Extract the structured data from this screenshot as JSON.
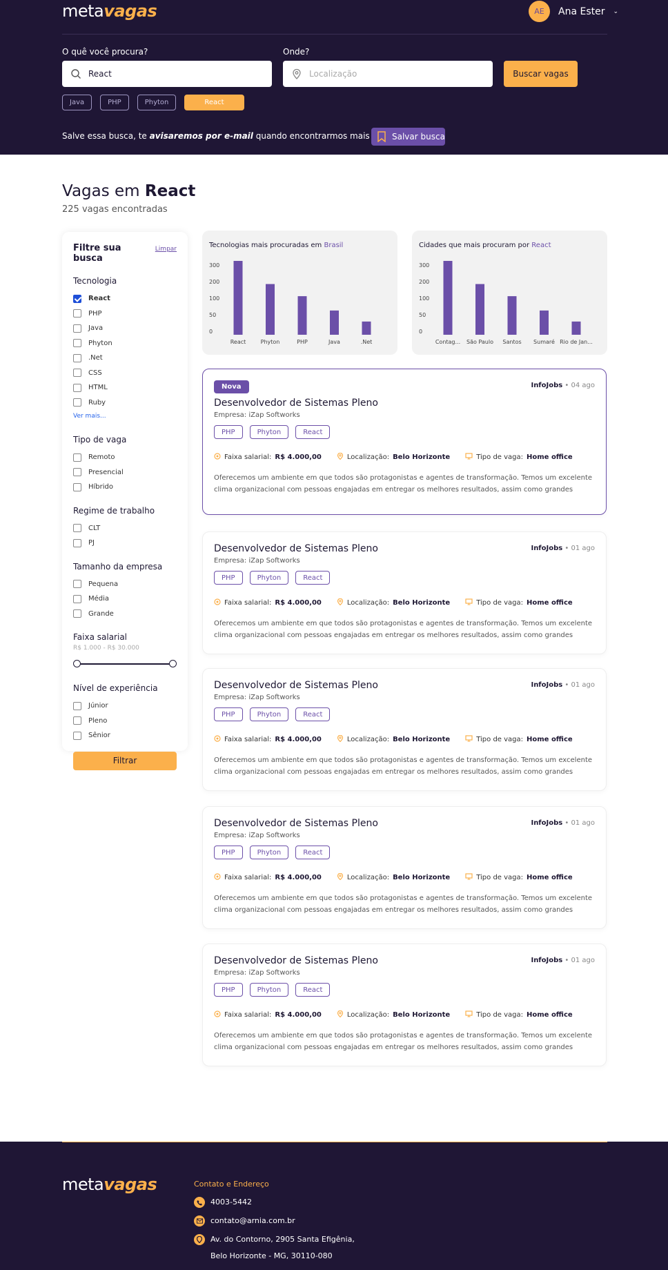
{
  "brand": {
    "logo_a": "meta",
    "logo_b": "vagas"
  },
  "user": {
    "initials": "AE",
    "name": "Ana Ester"
  },
  "search": {
    "what_label": "O quê você procura?",
    "what_value": "React",
    "where_label": "Onde?",
    "where_placeholder": "Localização",
    "button": "Buscar vagas"
  },
  "chips": [
    "Java",
    "PHP",
    "Phyton",
    "React"
  ],
  "save": {
    "text_a": "Salve essa busca, te ",
    "text_b": "avisaremos por e-mail",
    "text_c": " quando encontrarmos mais vagas",
    "button": "Salvar busca"
  },
  "results": {
    "title_a": "Vagas em ",
    "title_b": "React",
    "count": "225 vagas encontradas"
  },
  "filters": {
    "title": "Filtre sua busca",
    "clear": "Limpar",
    "tecnologia": {
      "label": "Tecnologia",
      "items": [
        {
          "label": "React",
          "checked": true
        },
        {
          "label": "PHP",
          "checked": false
        },
        {
          "label": "Java",
          "checked": false
        },
        {
          "label": "Phyton",
          "checked": false
        },
        {
          "label": ".Net",
          "checked": false
        },
        {
          "label": "CSS",
          "checked": false
        },
        {
          "label": "HTML",
          "checked": false
        },
        {
          "label": "Ruby",
          "checked": false
        }
      ],
      "more": "Ver mais..."
    },
    "tipo": {
      "label": "Tipo de vaga",
      "items": [
        "Remoto",
        "Presencial",
        "Híbrido"
      ]
    },
    "regime": {
      "label": "Regime de trabalho",
      "items": [
        "CLT",
        "PJ"
      ]
    },
    "tamanho": {
      "label": "Tamanho da empresa",
      "items": [
        "Pequena",
        "Média",
        "Grande"
      ]
    },
    "salario": {
      "label": "Faixa salarial",
      "range": "R$ 1.000 - R$ 30.000"
    },
    "nivel": {
      "label": "Nível de experiência",
      "items": [
        "Júnior",
        "Pleno",
        "Sênior"
      ]
    },
    "button": "Filtrar"
  },
  "chart_data": [
    {
      "type": "bar",
      "title_a": "Tecnologias mais procuradas em ",
      "title_b": "Brasil",
      "categories": [
        "React",
        "Phyton",
        "PHP",
        "Java",
        ".Net"
      ],
      "values": [
        335,
        230,
        175,
        110,
        60
      ],
      "yticks": [
        "300",
        "200",
        "100",
        "50",
        "0"
      ],
      "accent": "#6b4fa8"
    },
    {
      "type": "bar",
      "title_a": "Cidades que mais procuram por ",
      "title_b": "React",
      "categories": [
        "Contag...",
        "São Paulo",
        "Santos",
        "Sumaré",
        "Rio de Jan..."
      ],
      "values": [
        335,
        230,
        175,
        110,
        60
      ],
      "yticks": [
        "300",
        "200",
        "100",
        "50",
        "0"
      ],
      "accent": "#6b4fa8"
    }
  ],
  "jobs": [
    {
      "new": true,
      "badge": "Nova",
      "source": "InfoJobs",
      "ago": "04 ago",
      "title": "Desenvolvedor de Sistemas Pleno",
      "company": "Empresa: iZap Softworks",
      "tags": [
        "PHP",
        "Phyton",
        "React"
      ],
      "salary_label": "Faixa salarial: ",
      "salary": "R$ 4.000,00",
      "loc_label": "Localização: ",
      "loc": "Belo Horizonte",
      "type_label": "Tipo de vaga: ",
      "type": "Home office",
      "desc": "Oferecemos um ambiente em que todos são protagonistas e agentes de transformação. Temos um excelente clima organizacional com pessoas engajadas em entregar os melhores resultados, assim como grandes oportunidades..."
    },
    {
      "new": false,
      "source": "InfoJobs",
      "ago": "01 ago",
      "title": "Desenvolvedor de Sistemas Pleno",
      "company": "Empresa: iZap Softworks",
      "tags": [
        "PHP",
        "Phyton",
        "React"
      ],
      "salary_label": "Faixa salarial: ",
      "salary": "R$ 4.000,00",
      "loc_label": "Localização: ",
      "loc": "Belo Horizonte",
      "type_label": "Tipo de vaga: ",
      "type": "Home office",
      "desc": "Oferecemos um ambiente em que todos são protagonistas e agentes de transformação. Temos um excelente clima organizacional com pessoas engajadas em entregar os melhores resultados, assim como grandes oportunidades..."
    },
    {
      "new": false,
      "source": "InfoJobs",
      "ago": "01 ago",
      "title": "Desenvolvedor de Sistemas Pleno",
      "company": "Empresa: iZap Softworks",
      "tags": [
        "PHP",
        "Phyton",
        "React"
      ],
      "salary_label": "Faixa salarial: ",
      "salary": "R$ 4.000,00",
      "loc_label": "Localização: ",
      "loc": "Belo Horizonte",
      "type_label": "Tipo de vaga: ",
      "type": "Home office",
      "desc": "Oferecemos um ambiente em que todos são protagonistas e agentes de transformação. Temos um excelente clima organizacional com pessoas engajadas em entregar os melhores resultados, assim como grandes oportunidades..."
    },
    {
      "new": false,
      "source": "InfoJobs",
      "ago": "01 ago",
      "title": "Desenvolvedor de Sistemas Pleno",
      "company": "Empresa: iZap Softworks",
      "tags": [
        "PHP",
        "Phyton",
        "React"
      ],
      "salary_label": "Faixa salarial: ",
      "salary": "R$ 4.000,00",
      "loc_label": "Localização: ",
      "loc": "Belo Horizonte",
      "type_label": "Tipo de vaga: ",
      "type": "Home office",
      "desc": "Oferecemos um ambiente em que todos são protagonistas e agentes de transformação. Temos um excelente clima organizacional com pessoas engajadas em entregar os melhores resultados, assim como grandes oportunidades..."
    },
    {
      "new": false,
      "source": "InfoJobs",
      "ago": "01 ago",
      "title": "Desenvolvedor de Sistemas Pleno",
      "company": "Empresa: iZap Softworks",
      "tags": [
        "PHP",
        "Phyton",
        "React"
      ],
      "salary_label": "Faixa salarial: ",
      "salary": "R$ 4.000,00",
      "loc_label": "Localização: ",
      "loc": "Belo Horizonte",
      "type_label": "Tipo de vaga: ",
      "type": "Home office",
      "desc": "Oferecemos um ambiente em que todos são protagonistas e agentes de transformação. Temos um excelente clima organizacional com pessoas engajadas em entregar os melhores resultados, assim como grandes oportunidades..."
    }
  ],
  "footer": {
    "contact_title": "Contato e Endereço",
    "phone": "4003-5442",
    "email": "contato@arnia.com.br",
    "address_1": "Av. do Contorno, 2905 Santa Efigênia,",
    "address_2": "Belo Horizonte - MG, 30110-080"
  }
}
